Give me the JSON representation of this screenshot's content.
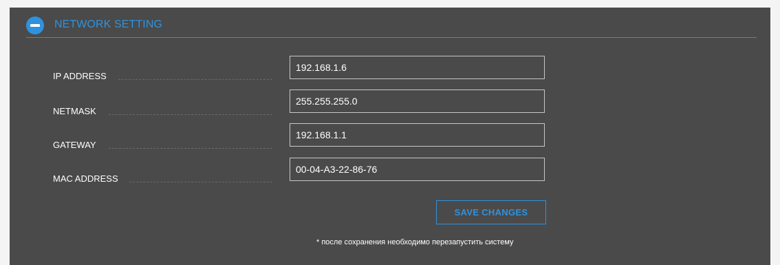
{
  "section": {
    "title": "NETWORK SETTING",
    "collapse_icon": "minus-circle-icon",
    "accent_color": "#2f92df"
  },
  "fields": {
    "ip_address": {
      "label": "IP ADDRESS",
      "value": "192.168.1.6"
    },
    "netmask": {
      "label": "NETMASK",
      "value": "255.255.255.0"
    },
    "gateway": {
      "label": "GATEWAY",
      "value": "192.168.1.1"
    },
    "mac_address": {
      "label": "MAC ADDRESS",
      "value": "00-04-A3-22-86-76"
    }
  },
  "actions": {
    "save_label": "SAVE CHANGES"
  },
  "note": "* после сохранения необходимо перезапустить систему"
}
